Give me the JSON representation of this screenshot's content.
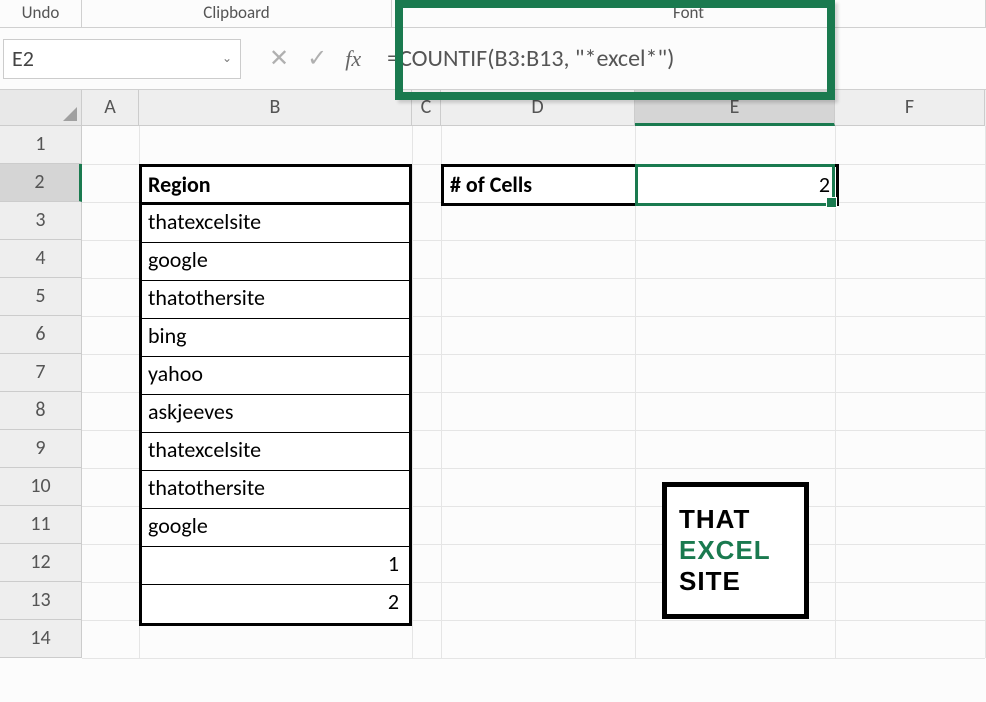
{
  "ribbon": {
    "undo": "Undo",
    "clipboard": "Clipboard",
    "font": "Font"
  },
  "namebox": "E2",
  "formula": "=COUNTIF(B3:B13, \"*excel*\")",
  "columns": [
    "A",
    "B",
    "C",
    "D",
    "E",
    "F"
  ],
  "rows": [
    "1",
    "2",
    "3",
    "4",
    "5",
    "6",
    "7",
    "8",
    "9",
    "10",
    "11",
    "12",
    "13",
    "14"
  ],
  "table": {
    "header": "Region",
    "data": [
      {
        "v": "thatexcelsite",
        "t": "text"
      },
      {
        "v": "google",
        "t": "text"
      },
      {
        "v": "thatothersite",
        "t": "text"
      },
      {
        "v": "bing",
        "t": "text"
      },
      {
        "v": "yahoo",
        "t": "text"
      },
      {
        "v": "askjeeves",
        "t": "text"
      },
      {
        "v": "thatexcelsite",
        "t": "text"
      },
      {
        "v": "thatothersite",
        "t": "text"
      },
      {
        "v": "google",
        "t": "text"
      },
      {
        "v": "1",
        "t": "num"
      },
      {
        "v": "2",
        "t": "num"
      }
    ]
  },
  "result": {
    "label": "# of Cells",
    "value": "2"
  },
  "logo": {
    "l1": "THAT",
    "l2": "EXCEL",
    "l3": "SITE"
  },
  "active_col": "E",
  "active_row": "2"
}
